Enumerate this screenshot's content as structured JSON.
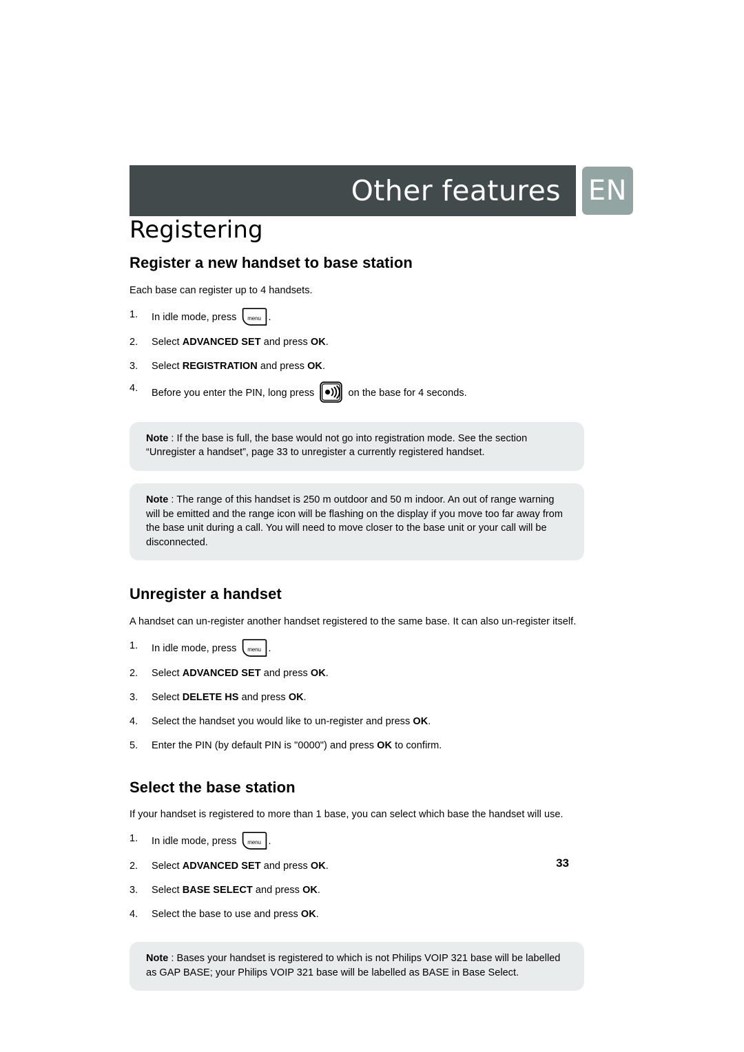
{
  "header": {
    "title": "Other features",
    "language_badge": "EN",
    "bar_color": "#434a4b",
    "badge_color": "#93a5a2"
  },
  "page_title": "Registering",
  "page_number": "33",
  "note_box_color": "#e9ecec",
  "icons": {
    "menu_key_label": "menu",
    "menu_key_name": "menu-key-icon",
    "paging_key_name": "paging-key-icon"
  },
  "sections": [
    {
      "heading": "Register a new handset to base station",
      "intro": "Each base can register up to 4 handsets.",
      "steps": [
        {
          "num": "1.",
          "pre": "In idle mode, press ",
          "icon": "menu",
          "post": "."
        },
        {
          "num": "2.",
          "pre": "Select ",
          "bold": "ADVANCED SET",
          "mid": " and press ",
          "bold2": "OK",
          "post": "."
        },
        {
          "num": "3.",
          "pre": "Select ",
          "bold": "REGISTRATION",
          "mid": " and press ",
          "bold2": "OK",
          "post": "."
        },
        {
          "num": "4.",
          "pre": "Before you enter the PIN, long press ",
          "icon": "paging",
          "post": " on the base for 4 seconds."
        }
      ],
      "notes": [
        {
          "label": "Note",
          "separator": " : ",
          "text": "If the base is full, the base would not go into registration mode. See the section “Unregister a handset”, page 33 to unregister a currently registered handset."
        },
        {
          "label": "Note",
          "separator": " : ",
          "text": "The range of this handset is 250 m outdoor and 50 m indoor.  An out of range warning will be emitted and the range icon will be flashing on the display if you move too far away from the base unit during a call. You will need to move closer to the base unit or your call will be disconnected."
        }
      ]
    },
    {
      "heading": "Unregister a handset",
      "intro": "A handset can un-register another handset registered to the same base. It can also un-register itself.",
      "steps": [
        {
          "num": "1.",
          "pre": "In idle mode, press ",
          "icon": "menu",
          "post": "."
        },
        {
          "num": "2.",
          "pre": "Select ",
          "bold": "ADVANCED SET",
          "mid": " and press ",
          "bold2": "OK",
          "post": "."
        },
        {
          "num": "3.",
          "pre": "Select ",
          "bold": "DELETE HS",
          "mid": " and press ",
          "bold2": "OK",
          "post": "."
        },
        {
          "num": "4.",
          "pre": "Select the handset you would like to un-register and press ",
          "bold2": "OK",
          "post": "."
        },
        {
          "num": "5.",
          "pre": "Enter the PIN (by default PIN is \"0000\") and press ",
          "bold2": "OK",
          "post": " to confirm."
        }
      ],
      "notes": []
    },
    {
      "heading": "Select the base station",
      "intro": "If your handset is registered to more than 1 base, you can select which base the handset will use.",
      "steps": [
        {
          "num": "1.",
          "pre": "In idle mode, press ",
          "icon": "menu",
          "post": "."
        },
        {
          "num": "2.",
          "pre": "Select ",
          "bold": "ADVANCED SET",
          "mid": " and press ",
          "bold2": "OK",
          "post": "."
        },
        {
          "num": "3.",
          "pre": "Select ",
          "bold": "BASE SELECT",
          "mid": " and press ",
          "bold2": "OK",
          "post": "."
        },
        {
          "num": "4.",
          "pre": "Select the base to use and press ",
          "bold2": "OK",
          "post": "."
        }
      ],
      "notes": [
        {
          "label": "Note",
          "separator": " : ",
          "text": "Bases your handset is registered to which is not Philips VOIP 321 base will be labelled as GAP BASE; your Philips VOIP 321 base will be labelled as BASE in Base Select."
        }
      ]
    }
  ]
}
